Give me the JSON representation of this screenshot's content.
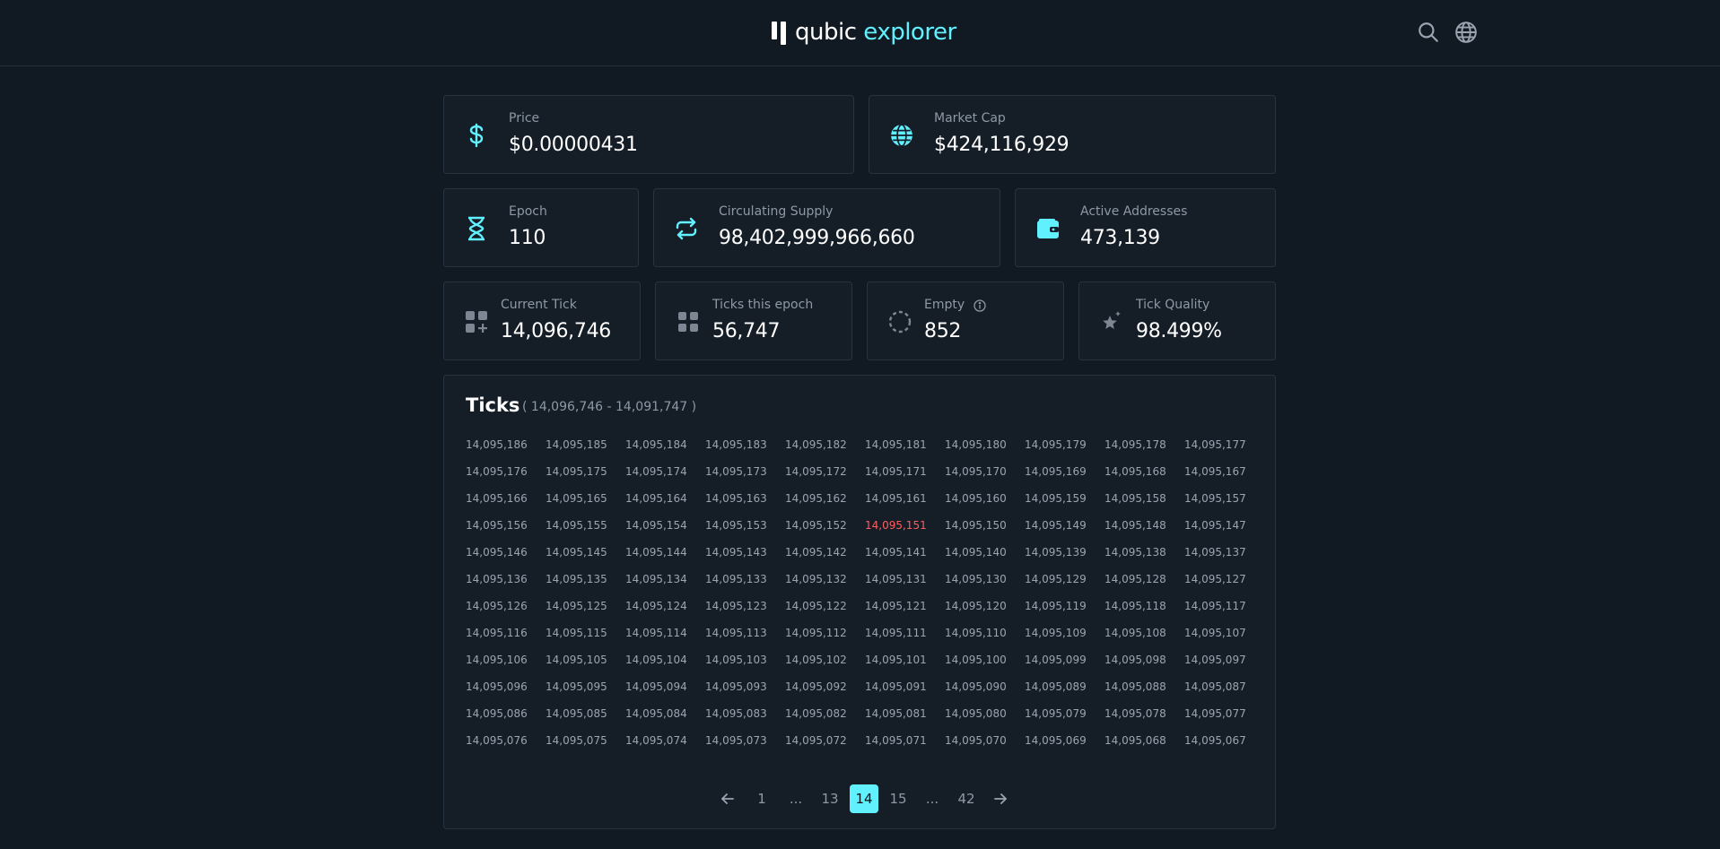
{
  "header": {
    "logo_primary": "qubic",
    "logo_accent": "explorer"
  },
  "colors": {
    "accent": "#61f0fe",
    "empty_tick": "#ff5d5d",
    "background": "#111a22",
    "card": "#151e27"
  },
  "stats": {
    "price": {
      "label": "Price",
      "value": "$0.00000431",
      "icon": "dollar-icon"
    },
    "market_cap": {
      "label": "Market Cap",
      "value": "$424,116,929",
      "icon": "globe-icon"
    },
    "epoch": {
      "label": "Epoch",
      "value": "110",
      "icon": "hourglass-icon"
    },
    "circulating_supply": {
      "label": "Circulating Supply",
      "value": "98,402,999,966,660",
      "icon": "exchange-icon"
    },
    "active_addresses": {
      "label": "Active Addresses",
      "value": "473,139",
      "icon": "wallet-icon"
    },
    "current_tick": {
      "label": "Current Tick",
      "value": "14,096,746",
      "icon": "grid-add-icon"
    },
    "ticks_this_epoch": {
      "label": "Ticks this epoch",
      "value": "56,747",
      "icon": "grid-icon"
    },
    "empty": {
      "label": "Empty",
      "value": "852",
      "icon": "dashed-circle-icon"
    },
    "tick_quality": {
      "label": "Tick Quality",
      "value": "98.499%",
      "icon": "sparkle-star-icon"
    }
  },
  "ticks": {
    "title": "Ticks",
    "range": "( 14,096,746 - 14,091,747 )",
    "items": [
      "14,095,186",
      "14,095,185",
      "14,095,184",
      "14,095,183",
      "14,095,182",
      "14,095,181",
      "14,095,180",
      "14,095,179",
      "14,095,178",
      "14,095,177",
      "14,095,176",
      "14,095,175",
      "14,095,174",
      "14,095,173",
      "14,095,172",
      "14,095,171",
      "14,095,170",
      "14,095,169",
      "14,095,168",
      "14,095,167",
      "14,095,166",
      "14,095,165",
      "14,095,164",
      "14,095,163",
      "14,095,162",
      "14,095,161",
      "14,095,160",
      "14,095,159",
      "14,095,158",
      "14,095,157",
      "14,095,156",
      "14,095,155",
      "14,095,154",
      "14,095,153",
      "14,095,152",
      "14,095,151",
      "14,095,150",
      "14,095,149",
      "14,095,148",
      "14,095,147",
      "14,095,146",
      "14,095,145",
      "14,095,144",
      "14,095,143",
      "14,095,142",
      "14,095,141",
      "14,095,140",
      "14,095,139",
      "14,095,138",
      "14,095,137",
      "14,095,136",
      "14,095,135",
      "14,095,134",
      "14,095,133",
      "14,095,132",
      "14,095,131",
      "14,095,130",
      "14,095,129",
      "14,095,128",
      "14,095,127",
      "14,095,126",
      "14,095,125",
      "14,095,124",
      "14,095,123",
      "14,095,122",
      "14,095,121",
      "14,095,120",
      "14,095,119",
      "14,095,118",
      "14,095,117",
      "14,095,116",
      "14,095,115",
      "14,095,114",
      "14,095,113",
      "14,095,112",
      "14,095,111",
      "14,095,110",
      "14,095,109",
      "14,095,108",
      "14,095,107",
      "14,095,106",
      "14,095,105",
      "14,095,104",
      "14,095,103",
      "14,095,102",
      "14,095,101",
      "14,095,100",
      "14,095,099",
      "14,095,098",
      "14,095,097",
      "14,095,096",
      "14,095,095",
      "14,095,094",
      "14,095,093",
      "14,095,092",
      "14,095,091",
      "14,095,090",
      "14,095,089",
      "14,095,088",
      "14,095,087",
      "14,095,086",
      "14,095,085",
      "14,095,084",
      "14,095,083",
      "14,095,082",
      "14,095,081",
      "14,095,080",
      "14,095,079",
      "14,095,078",
      "14,095,077",
      "14,095,076",
      "14,095,075",
      "14,095,074",
      "14,095,073",
      "14,095,072",
      "14,095,071",
      "14,095,070",
      "14,095,069",
      "14,095,068",
      "14,095,067"
    ],
    "empty_items": [
      "14,095,151"
    ]
  },
  "pagination": {
    "prev_icon": "arrow-left-icon",
    "next_icon": "arrow-right-icon",
    "pages": [
      "1",
      "...",
      "13",
      "14",
      "15",
      "...",
      "42"
    ],
    "current": "14"
  }
}
